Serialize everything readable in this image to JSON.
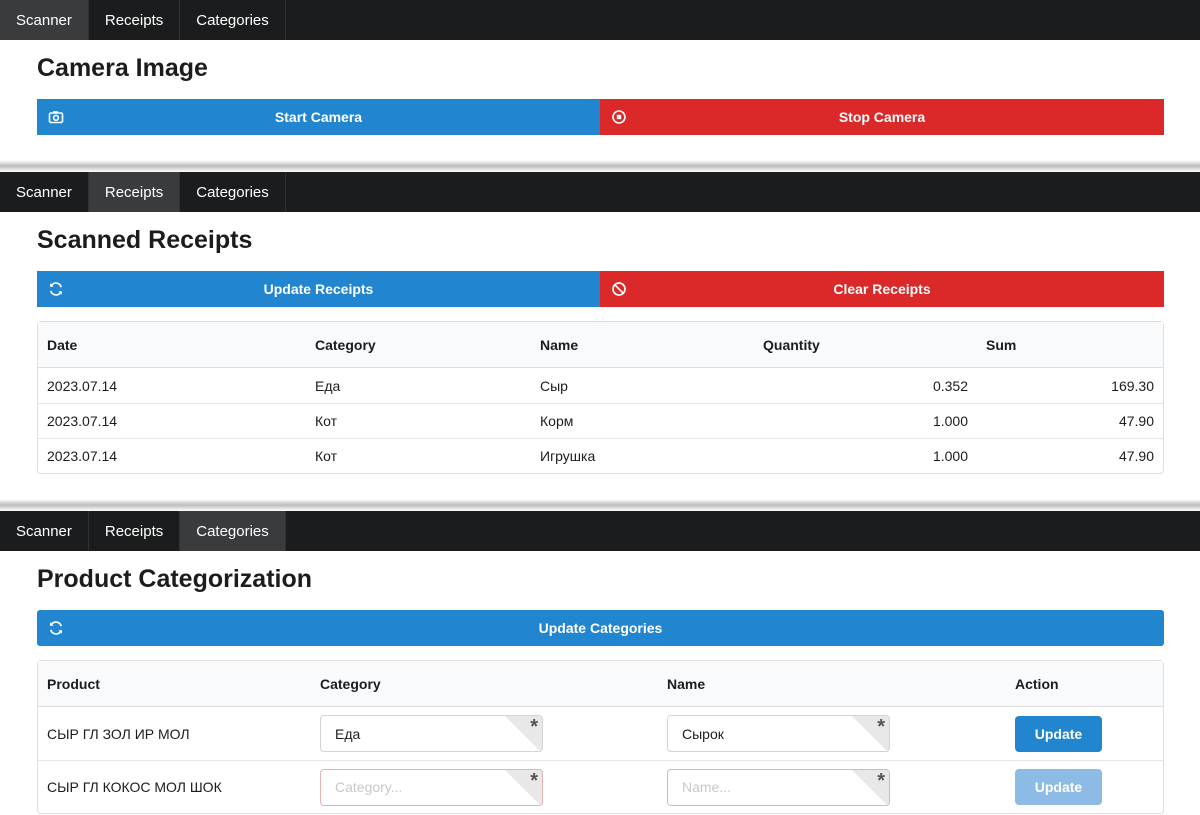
{
  "nav": {
    "scanner": "Scanner",
    "receipts": "Receipts",
    "categories": "Categories"
  },
  "scanner_view": {
    "title": "Camera Image",
    "start_label": "Start Camera",
    "stop_label": "Stop Camera"
  },
  "receipts_view": {
    "title": "Scanned Receipts",
    "update_label": "Update Receipts",
    "clear_label": "Clear Receipts",
    "columns": [
      "Date",
      "Category",
      "Name",
      "Quantity",
      "Sum"
    ],
    "rows": [
      {
        "date": "2023.07.14",
        "category": "Еда",
        "name": "Сыр",
        "quantity": "0.352",
        "sum": "169.30"
      },
      {
        "date": "2023.07.14",
        "category": "Кот",
        "name": "Корм",
        "quantity": "1.000",
        "sum": "47.90"
      },
      {
        "date": "2023.07.14",
        "category": "Кот",
        "name": "Игрушка",
        "quantity": "1.000",
        "sum": "47.90"
      }
    ]
  },
  "categories_view": {
    "title": "Product Categorization",
    "update_label": "Update Categories",
    "columns": [
      "Product",
      "Category",
      "Name",
      "Action"
    ],
    "rows": [
      {
        "product": "СЫР ГЛ ЗОЛ ИР МОЛ",
        "category": "Еда",
        "name": "Сырок",
        "action": "Update"
      },
      {
        "product": "СЫР ГЛ КОКОС МОЛ ШОК",
        "category_placeholder": "Category...",
        "name_placeholder": "Name...",
        "action": "Update"
      }
    ],
    "required_mark": "*"
  },
  "colors": {
    "primary": "#2185d0",
    "danger": "#db2828",
    "navbar": "#1b1c1d"
  }
}
